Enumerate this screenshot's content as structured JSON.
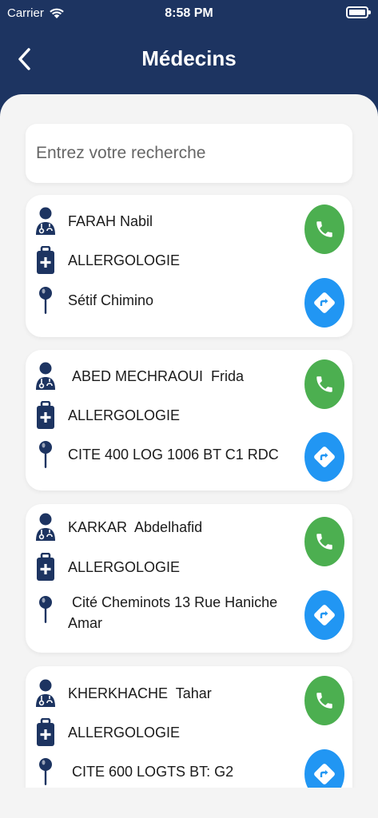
{
  "status": {
    "carrier": "Carrier",
    "time": "8:58 PM"
  },
  "header": {
    "title": "Médecins"
  },
  "search": {
    "placeholder": "Entrez votre recherche",
    "value": ""
  },
  "colors": {
    "nav": "#1d3461",
    "call": "#4caf50",
    "directions": "#2196f3",
    "icon": "#1d3461"
  },
  "icons": {
    "name": "doctor-icon",
    "specialty": "medical-bag-icon",
    "address": "map-pin-icon",
    "call": "phone-icon",
    "directions": "directions-icon"
  },
  "doctors": [
    {
      "name": "FARAH Nabil",
      "specialty": "ALLERGOLOGIE",
      "address": "Sétif Chimino"
    },
    {
      "name": " ABED MECHRAOUI  Frida",
      "specialty": "ALLERGOLOGIE",
      "address": "CITE 400 LOG 1006 BT C1 RDC"
    },
    {
      "name": "KARKAR  Abdelhafid",
      "specialty": "ALLERGOLOGIE",
      "address": " Cité Cheminots 13 Rue Haniche Amar"
    },
    {
      "name": "KHERKHACHE  Tahar",
      "specialty": "ALLERGOLOGIE",
      "address": " CITE 600 LOGTS BT: G2"
    }
  ]
}
